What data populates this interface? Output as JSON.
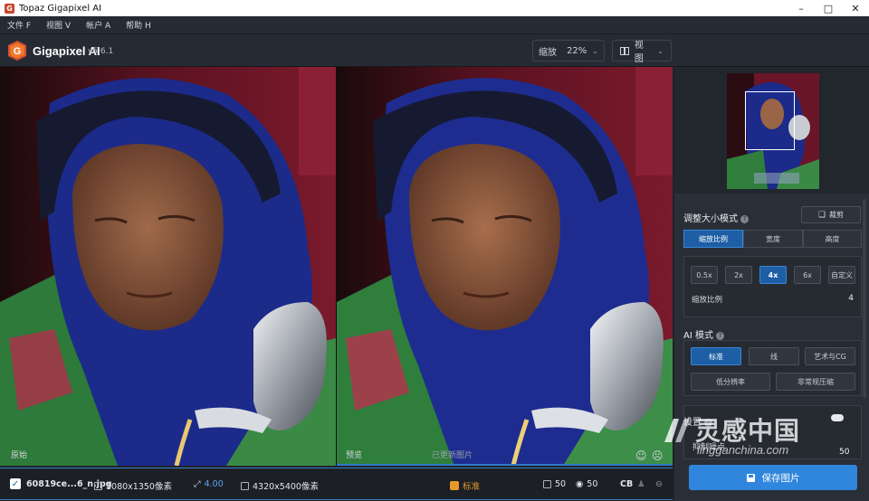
{
  "window": {
    "title": "Topaz Gigapixel AI"
  },
  "menu": [
    {
      "label": "文件 F"
    },
    {
      "label": "视图 V"
    },
    {
      "label": "帐户 A"
    },
    {
      "label": "帮助 H"
    }
  ],
  "header": {
    "brand": "Gigapixel AI",
    "version": "v5.6.1",
    "zoom_label": "缩放",
    "zoom_value": "22%",
    "view_label": "视图"
  },
  "panes": {
    "left_label": "原始",
    "right_label": "预览",
    "right_status": "已更新图片"
  },
  "status": {
    "filename": "60819ce...6_n.jpg",
    "input_size": "1080x1350像素",
    "scale": "4.00",
    "output_size": "4320x5400像素",
    "mode": "标准",
    "noise": "50",
    "blur": "50",
    "cb": "CB"
  },
  "resize": {
    "title": "调整大小模式",
    "crop_label": "裁剪",
    "modes": [
      "缩放比例",
      "宽度",
      "高度"
    ],
    "active_mode": "缩放比例",
    "scales": [
      "0.5x",
      "2x",
      "4x",
      "6x",
      "自定义"
    ],
    "active_scale": "4x",
    "scale_label": "缩放比例",
    "scale_value": "4"
  },
  "ai_model": {
    "title": "AI 模式",
    "options": [
      "标准",
      "线",
      "艺术与CG",
      "低分辨率",
      "非常规压缩"
    ],
    "active": "标准"
  },
  "settings": {
    "title": "设置",
    "row_label": "抑制噪点",
    "row_value": "50"
  },
  "save_button": "保存图片",
  "watermark": {
    "cn": "灵感中国",
    "en": "lingganchina.com"
  },
  "colors": {
    "accent": "#2f86dc",
    "active_segment": "#1d5ea5",
    "mode_orange": "#e59a2a",
    "panel_bg": "#2a2f37"
  }
}
